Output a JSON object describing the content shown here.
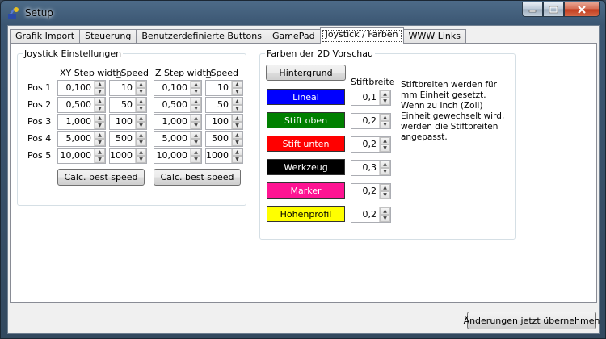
{
  "window": {
    "title": "Setup"
  },
  "tabs": [
    "Grafik Import",
    "Steuerung",
    "Benutzerdefinierte Buttons",
    "GamePad",
    "Joystick / Farben",
    "WWW Links"
  ],
  "active_tab": "Joystick / Farben",
  "joystick": {
    "legend": "Joystick Einstellungen",
    "xy_header": "XY Step width",
    "speed_header_1": "Speed",
    "z_header": "Z Step width",
    "speed_header_2": "Speed",
    "rows": [
      {
        "label": "Pos 1",
        "xy": "0,100",
        "xy_speed": "10",
        "z": "0,100",
        "z_speed": "10"
      },
      {
        "label": "Pos 2",
        "xy": "0,500",
        "xy_speed": "50",
        "z": "0,500",
        "z_speed": "50"
      },
      {
        "label": "Pos 3",
        "xy": "1,000",
        "xy_speed": "100",
        "z": "1,000",
        "z_speed": "100"
      },
      {
        "label": "Pos 4",
        "xy": "5,000",
        "xy_speed": "500",
        "z": "5,000",
        "z_speed": "500"
      },
      {
        "label": "Pos 5",
        "xy": "10,000",
        "xy_speed": "1000",
        "z": "10,000",
        "z_speed": "1000"
      }
    ],
    "calc_xy_label": "Calc. best speed",
    "calc_z_label": "Calc. best speed"
  },
  "farben": {
    "legend": "Farben der 2D Vorschau",
    "background_label": "Hintergrund",
    "width_header": "Stiftbreite",
    "note": "Stiftbreiten werden für mm Einheit gesetzt. Wenn zu Inch (Zoll) Einheit gewechselt wird, werden die Stiftbreiten angepasst.",
    "pens": [
      {
        "label": "Lineal",
        "color": "#0000ff",
        "text_color": "#ffffff",
        "width": "0,1"
      },
      {
        "label": "Stift oben",
        "color": "#008000",
        "text_color": "#ffffff",
        "width": "0,2"
      },
      {
        "label": "Stift unten",
        "color": "#ff0000",
        "text_color": "#ffffff",
        "width": "0,2"
      },
      {
        "label": "Werkzeug",
        "color": "#000000",
        "text_color": "#ffffff",
        "width": "0,3"
      },
      {
        "label": "Marker",
        "color": "#ff1493",
        "text_color": "#ffffff",
        "width": "0,2"
      },
      {
        "label": "Höhenprofil",
        "color": "#ffff00",
        "text_color": "#000000",
        "width": "0,2"
      }
    ]
  },
  "footer": {
    "apply_label": "Änderungen jetzt übernehmen"
  }
}
